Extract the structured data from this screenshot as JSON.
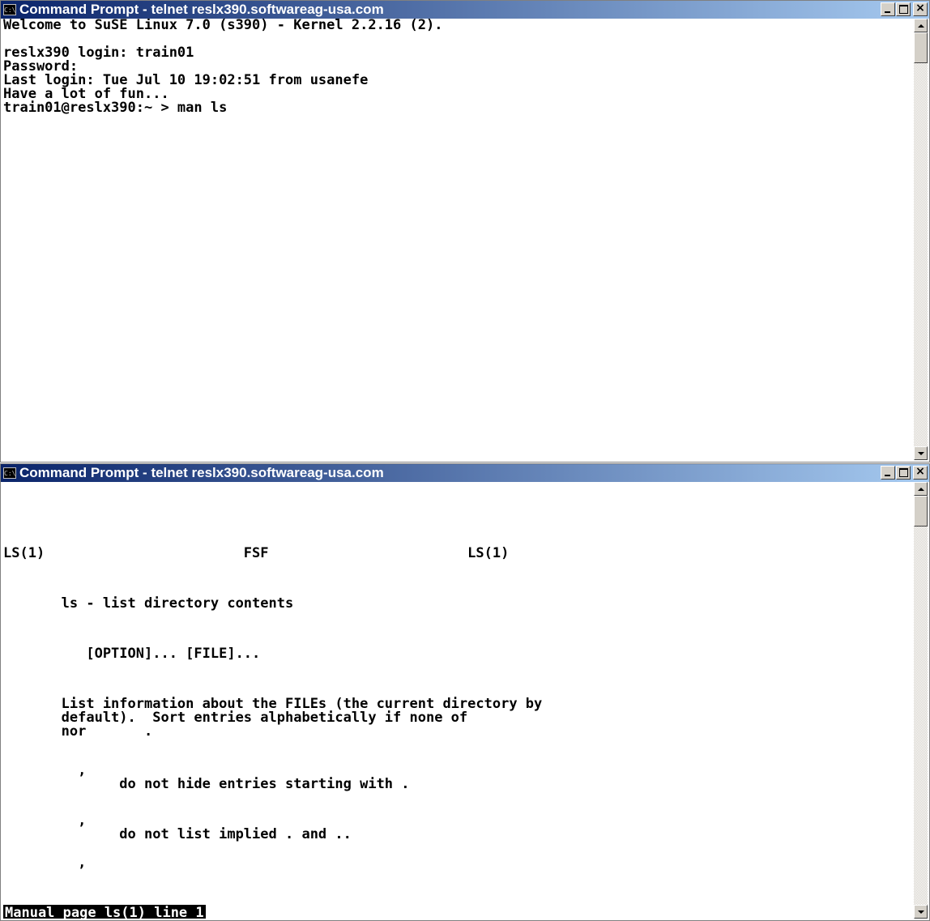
{
  "windows": [
    {
      "title": "Command Prompt - telnet reslx390.softwareag-usa.com",
      "lines": [
        "Welcome to SuSE Linux 7.0 (s390) - Kernel 2.2.16 (2).",
        "",
        "reslx390 login: train01",
        "Password:",
        "Last login: Tue Jul 10 19:02:51 from usanefe",
        "Have a lot of fun...",
        "train01@reslx390:~ > man ls"
      ]
    },
    {
      "title": "Command Prompt - telnet reslx390.softwareag-usa.com",
      "lines": [
        "LS(1)                        FSF                        LS(1)",
        "       ls - list directory contents",
        "          [OPTION]... [FILE]...",
        "       List information about the FILEs (the current directory by",
        "       default).  Sort entries alphabetically if none of",
        "       nor       .",
        "         ,",
        "              do not hide entries starting with .",
        "         ,",
        "              do not list implied . and ..",
        "         ,"
      ],
      "status": "Manual page ls(1) line 1"
    }
  ]
}
